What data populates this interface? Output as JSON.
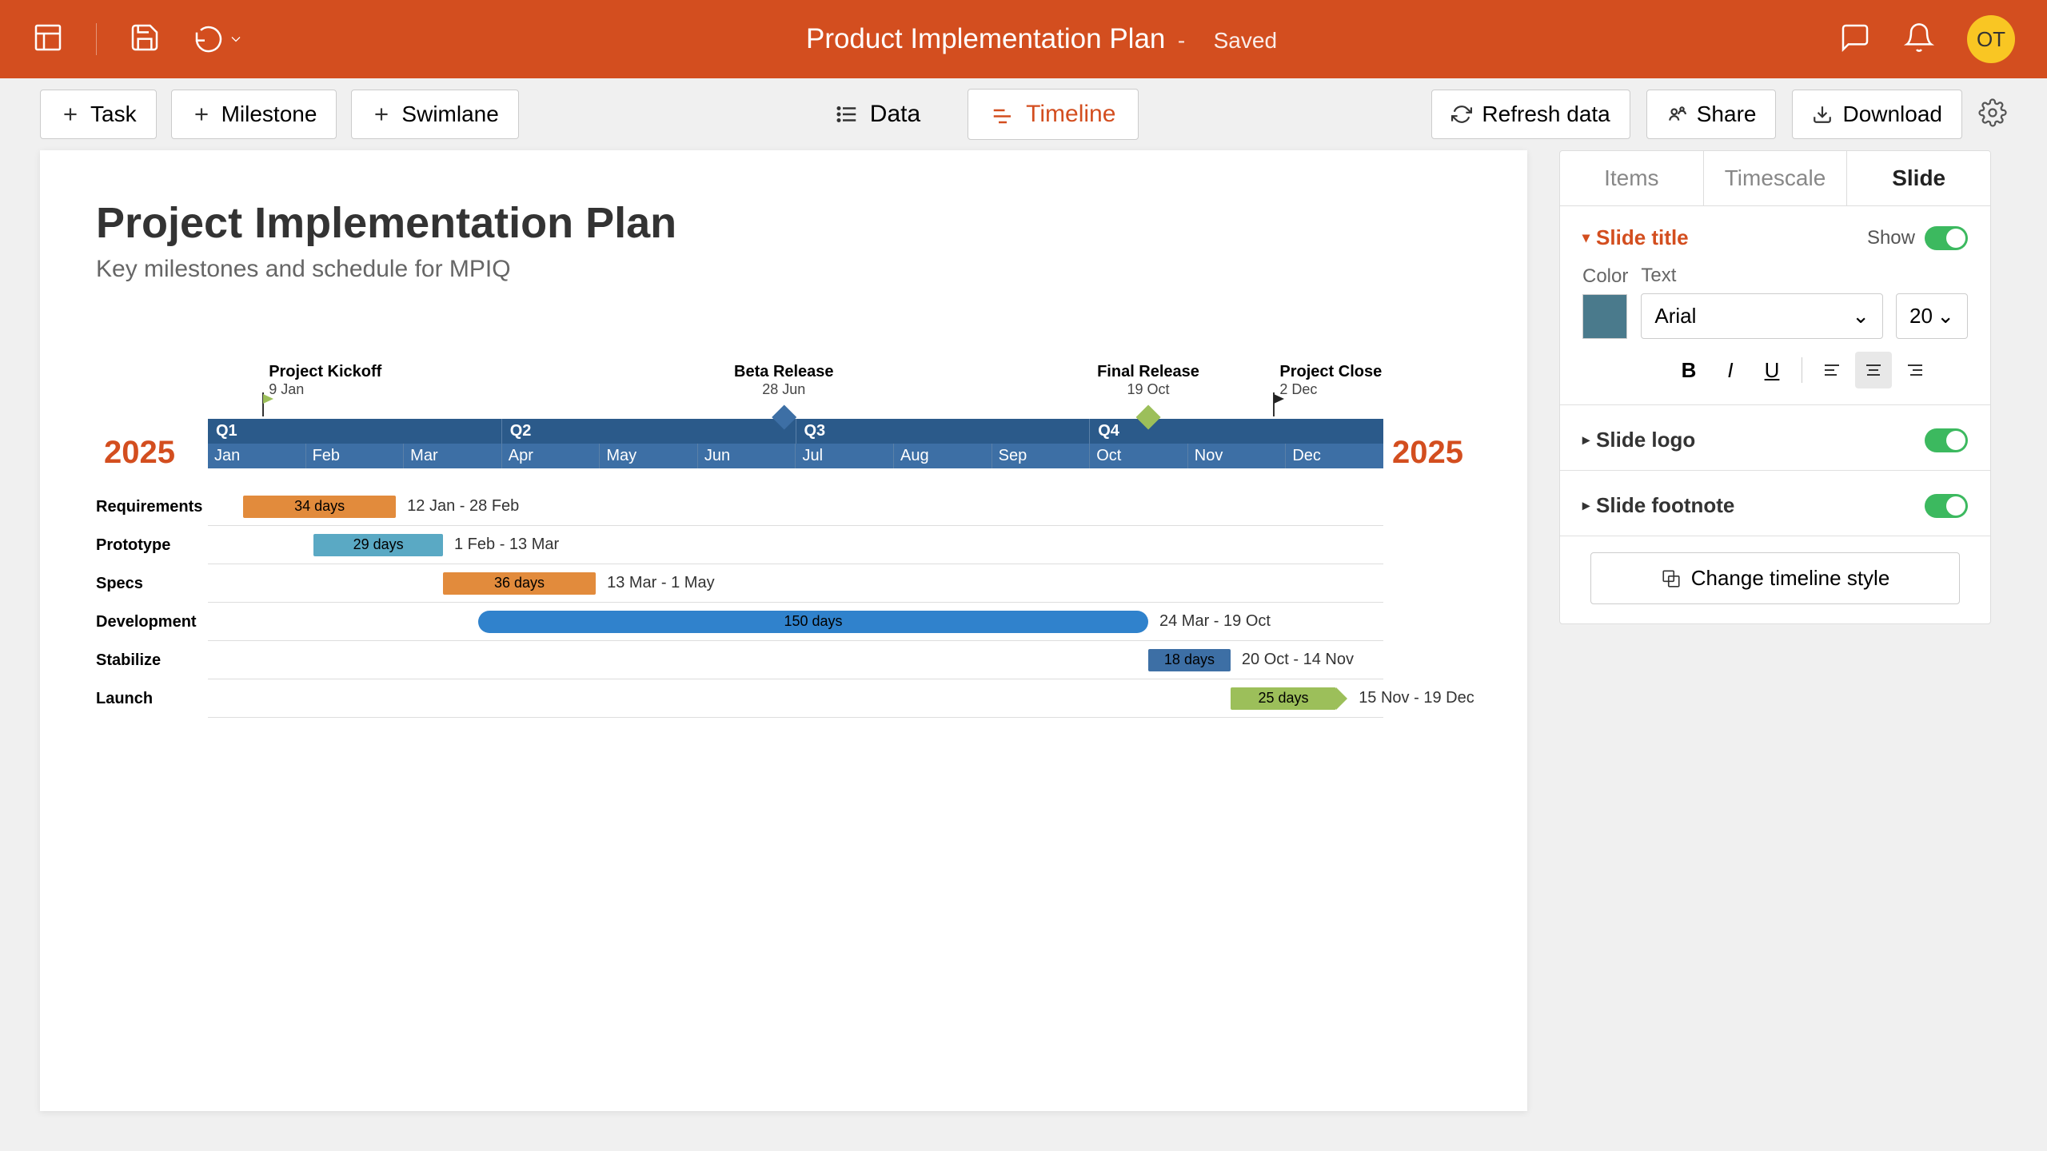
{
  "header": {
    "title": "Product Implementation Plan",
    "status": "Saved",
    "avatar": "OT"
  },
  "toolbar": {
    "task": "Task",
    "milestone": "Milestone",
    "swimlane": "Swimlane",
    "data": "Data",
    "timeline": "Timeline",
    "refresh": "Refresh data",
    "share": "Share",
    "download": "Download"
  },
  "slide": {
    "title": "Project Implementation Plan",
    "subtitle": "Key milestones and schedule for MPIQ",
    "year_left": "2025",
    "year_right": "2025",
    "quarters": [
      "Q1",
      "Q2",
      "Q3",
      "Q4"
    ],
    "months": [
      "Jan",
      "Feb",
      "Mar",
      "Apr",
      "May",
      "Jun",
      "Jul",
      "Aug",
      "Sep",
      "Oct",
      "Nov",
      "Dec"
    ],
    "milestones": [
      {
        "name": "Project Kickoff",
        "date": "9 Jan",
        "pos": 6,
        "type": "flag",
        "color": "#9cbf5a",
        "align": "left"
      },
      {
        "name": "Beta Release",
        "date": "28 Jun",
        "pos": 49,
        "type": "diamond",
        "color": "#3d6fa5"
      },
      {
        "name": "Final Release",
        "date": "19 Oct",
        "pos": 80,
        "type": "diamond",
        "color": "#9cbf5a"
      },
      {
        "name": "Project Close",
        "date": "2 Dec",
        "pos": 92,
        "type": "flag",
        "color": "#222",
        "align": "left"
      }
    ],
    "tasks": [
      {
        "name": "Requirements",
        "duration": "34 days",
        "dates": "12 Jan - 28 Feb",
        "start": 3,
        "width": 13,
        "color": "#e28b3c"
      },
      {
        "name": "Prototype",
        "duration": "29 days",
        "dates": "1 Feb - 13 Mar",
        "start": 9,
        "width": 11,
        "color": "#5aa9c4"
      },
      {
        "name": "Specs",
        "duration": "36 days",
        "dates": "13 Mar - 1 May",
        "start": 20,
        "width": 13,
        "color": "#e28b3c"
      },
      {
        "name": "Development",
        "duration": "150 days",
        "dates": "24 Mar - 19 Oct",
        "start": 23,
        "width": 57,
        "color": "#3082cc",
        "rounded": true
      },
      {
        "name": "Stabilize",
        "duration": "18 days",
        "dates": "20 Oct - 14 Nov",
        "start": 80,
        "width": 7,
        "color": "#3d6fa5"
      },
      {
        "name": "Launch",
        "duration": "25 days",
        "dates": "15 Nov - 19 Dec",
        "start": 87,
        "width": 9,
        "color": "#9cbf5a",
        "arrow": true
      }
    ]
  },
  "panel": {
    "tabs": {
      "items": "Items",
      "timescale": "Timescale",
      "slide": "Slide"
    },
    "section_title": "Slide title",
    "show": "Show",
    "color_label": "Color",
    "text_label": "Text",
    "font": "Arial",
    "font_size": "20",
    "logo": "Slide logo",
    "footnote": "Slide footnote",
    "change_style": "Change timeline style"
  }
}
